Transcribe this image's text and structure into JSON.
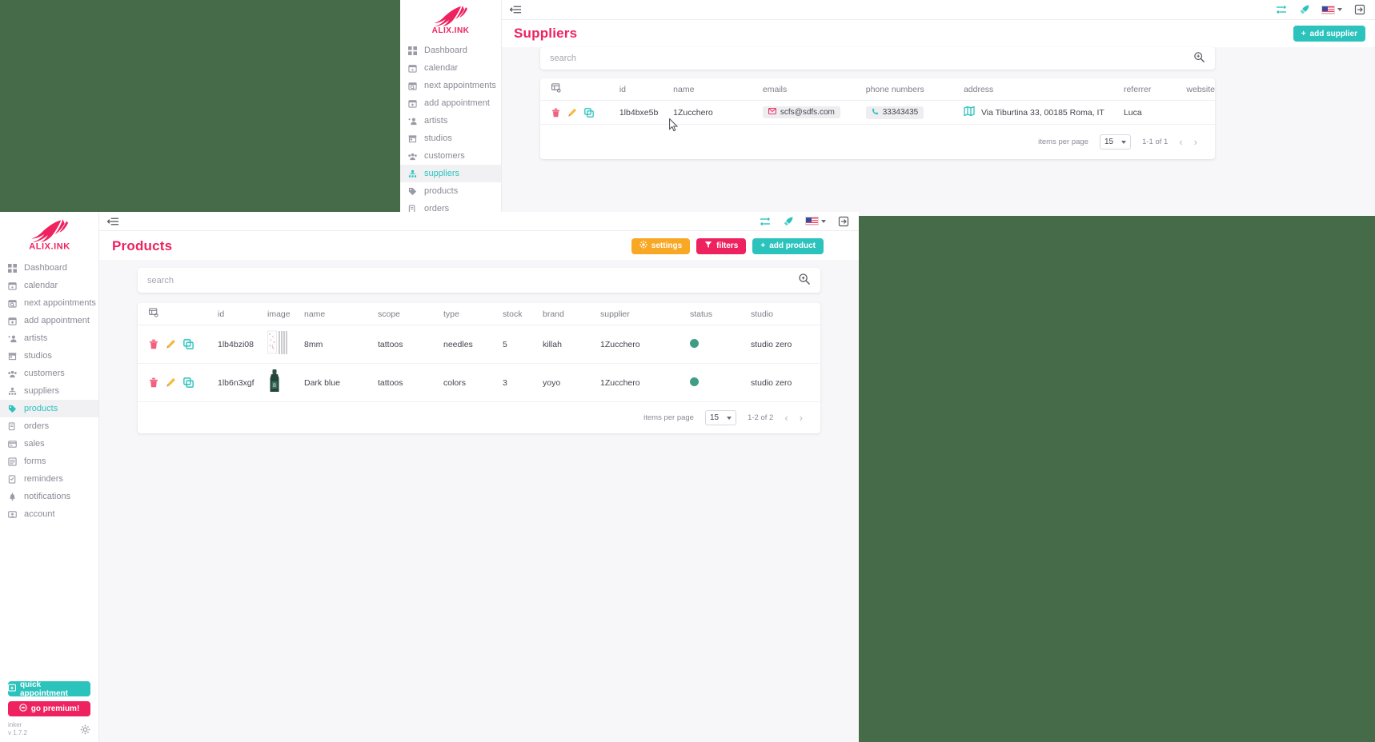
{
  "desktop": {
    "background_color": "#466b48"
  },
  "brand": {
    "name": "ALIX.INK",
    "accent_pink": "#ee225e",
    "accent_teal": "#2cc3bd"
  },
  "nav_items": [
    {
      "label": "Dashboard",
      "icon": "dashboard-icon"
    },
    {
      "label": "calendar",
      "icon": "calendar-icon"
    },
    {
      "label": "next appointments",
      "icon": "calendar-search-icon"
    },
    {
      "label": "add appointment",
      "icon": "calendar-plus-icon"
    },
    {
      "label": "artists",
      "icon": "artists-icon"
    },
    {
      "label": "studios",
      "icon": "studio-icon"
    },
    {
      "label": "customers",
      "icon": "customers-icon"
    },
    {
      "label": "suppliers",
      "icon": "supplier-icon"
    },
    {
      "label": "products",
      "icon": "tag-icon"
    },
    {
      "label": "orders",
      "icon": "orders-icon"
    },
    {
      "label": "sales",
      "icon": "sales-icon"
    },
    {
      "label": "forms",
      "icon": "forms-icon"
    },
    {
      "label": "reminders",
      "icon": "reminders-icon"
    },
    {
      "label": "notifications",
      "icon": "bell-icon"
    },
    {
      "label": "account",
      "icon": "account-icon"
    }
  ],
  "suppliers_window": {
    "topbar": {
      "collapse_icon": "collapse-sidebar-icon",
      "tools": [
        "list-settings-icon",
        "rocket-icon",
        "language-flag-icon",
        "logout-icon"
      ]
    },
    "page_title": "Suppliers",
    "add_button": {
      "label": "add supplier",
      "icon": "plus-icon"
    },
    "search": {
      "placeholder": "search",
      "icon": "search-icon"
    },
    "table": {
      "columns_icon": "column-settings-icon",
      "columns": [
        "id",
        "name",
        "emails",
        "phone numbers",
        "address",
        "referrer",
        "website"
      ],
      "rows": [
        {
          "id": "1lb4bxe5b",
          "name": "1Zucchero",
          "email": "scfs@sdfs.com",
          "phone": "33343435",
          "address": "Via Tiburtina 33, 00185 Roma, IT",
          "referrer": "Luca",
          "website": ""
        }
      ],
      "row_actions": [
        "delete-icon",
        "edit-icon",
        "duplicate-icon"
      ]
    },
    "pager": {
      "label": "items per page",
      "per_page": "15",
      "range": "1-1 of 1",
      "prev": "‹",
      "next": "›"
    }
  },
  "products_window": {
    "topbar": {
      "collapse_icon": "collapse-sidebar-icon",
      "tools": [
        "list-settings-icon",
        "rocket-icon",
        "language-flag-icon",
        "logout-icon"
      ]
    },
    "page_title": "Products",
    "buttons": [
      {
        "label": "settings",
        "icon": "gear-icon",
        "color": "#f9a825"
      },
      {
        "label": "filters",
        "icon": "funnel-icon",
        "color": "#ee225e"
      },
      {
        "label": "add product",
        "icon": "plus-icon",
        "color": "#2cc3bd"
      }
    ],
    "search": {
      "placeholder": "search",
      "icon": "search-icon"
    },
    "active_nav": "products",
    "table": {
      "columns_icon": "column-settings-icon",
      "columns": [
        "id",
        "image",
        "name",
        "scope",
        "type",
        "stock",
        "brand",
        "supplier",
        "status",
        "studio"
      ],
      "rows": [
        {
          "id": "1lb4bzi08",
          "image": "needles-thumbnail",
          "name": "8mm",
          "scope": "tattoos",
          "type": "needles",
          "stock": "5",
          "brand": "killah",
          "supplier": "1Zucchero",
          "status": "active",
          "studio": "studio zero"
        },
        {
          "id": "1lb6n3xgf",
          "image": "ink-bottle-thumbnail",
          "name": "Dark blue",
          "scope": "tattoos",
          "type": "colors",
          "stock": "3",
          "brand": "yoyo",
          "supplier": "1Zucchero",
          "status": "active",
          "studio": "studio zero"
        }
      ],
      "row_actions": [
        "delete-icon",
        "edit-icon",
        "duplicate-icon"
      ]
    },
    "pager": {
      "label": "items per page",
      "per_page": "15",
      "range": "1-2 of 2",
      "prev": "‹",
      "next": "›"
    },
    "sidebar_footer": {
      "quick_appointment": {
        "label": "quick appointment",
        "icon": "quick-appointment-icon"
      },
      "go_premium": {
        "label": "go premium!",
        "icon": "crown-icon"
      },
      "user": "inker",
      "version": "v 1.7.2",
      "settings_icon": "gear-icon"
    }
  }
}
